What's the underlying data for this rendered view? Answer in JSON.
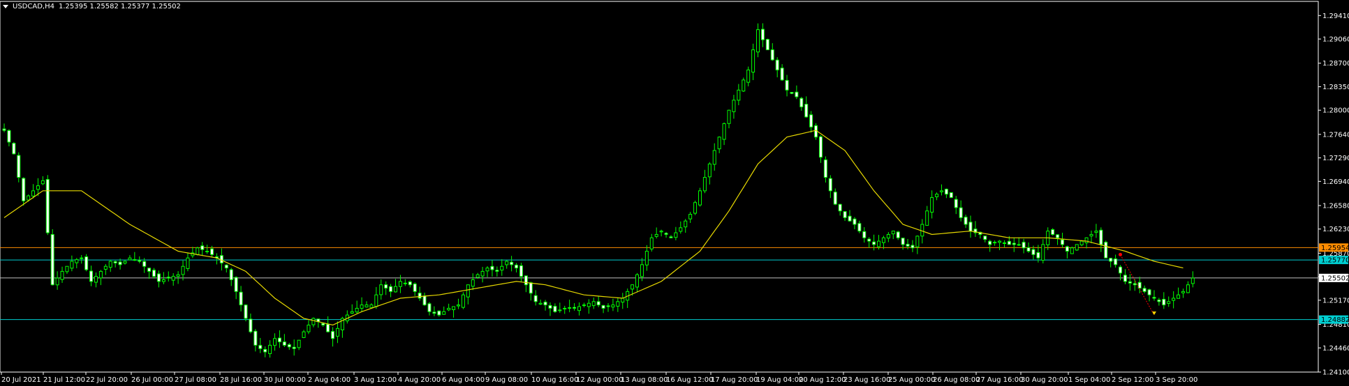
{
  "header": {
    "symbol": "USDCAD,H4",
    "ohlc": "1.25395 1.25582 1.25377 1.25502"
  },
  "price_axis": {
    "labels": [
      "1.29410",
      "1.29060",
      "1.28700",
      "1.28350",
      "1.28000",
      "1.27640",
      "1.27290",
      "1.26940",
      "1.26580",
      "1.26230",
      "1.25870",
      "1.25520",
      "1.25170",
      "1.24810",
      "1.24460",
      "1.24100"
    ]
  },
  "time_axis": {
    "labels": [
      "20 Jul 2021",
      "21 Jul 12:00",
      "22 Jul 20:00",
      "26 Jul 00:00",
      "27 Jul 08:00",
      "28 Jul 16:00",
      "30 Jul 00:00",
      "2 Aug 04:00",
      "3 Aug 12:00",
      "4 Aug 20:00",
      "6 Aug 04:00",
      "9 Aug 08:00",
      "10 Aug 16:00",
      "12 Aug 00:00",
      "13 Aug 08:00",
      "16 Aug 12:00",
      "17 Aug 20:00",
      "19 Aug 04:00",
      "20 Aug 12:00",
      "23 Aug 16:00",
      "25 Aug 00:00",
      "26 Aug 08:00",
      "27 Aug 16:00",
      "30 Aug 20:00",
      "1 Sep 04:00",
      "2 Sep 12:00",
      "3 Sep 20:00"
    ]
  },
  "price_tags": [
    {
      "name": "orange-level-tag",
      "value": "1.25954",
      "bg": "#FF8C00",
      "fg": "#000000"
    },
    {
      "name": "upper-cyan-level-tag",
      "value": "1.25770",
      "bg": "#00CED1",
      "fg": "#000000"
    },
    {
      "name": "current-price-tag",
      "value": "1.25502",
      "bg": "#FFFFFF",
      "fg": "#000000"
    },
    {
      "name": "lower-cyan-level-tag",
      "value": "1.24882",
      "bg": "#00CED1",
      "fg": "#000000"
    }
  ],
  "colors": {
    "background": "#000000",
    "candle": "#00FF00",
    "bull_body": "#FFFFFF",
    "bear_body": "#FFFFFF",
    "moving_average": "#E6D800",
    "orange_level": "#FF8C00",
    "cyan_level": "#00CED1",
    "current_price_line": "#C0C0C0",
    "trade_arrow": "#FF0000"
  },
  "chart_data": {
    "type": "candlestick",
    "symbol": "USDCAD",
    "timeframe": "H4",
    "ylim": [
      1.241,
      1.296
    ],
    "levels": {
      "orange": 1.25954,
      "cyan_upper": 1.2577,
      "current": 1.25502,
      "cyan_lower": 1.24882
    },
    "close_path": [
      [
        0,
        1.277
      ],
      [
        2,
        1.2735
      ],
      [
        4,
        1.2665
      ],
      [
        6,
        1.268
      ],
      [
        8,
        1.2695
      ],
      [
        10,
        1.254
      ],
      [
        12,
        1.256
      ],
      [
        14,
        1.2575
      ],
      [
        16,
        1.258
      ],
      [
        18,
        1.2545
      ],
      [
        20,
        1.256
      ],
      [
        22,
        1.2575
      ],
      [
        24,
        1.257
      ],
      [
        26,
        1.258
      ],
      [
        28,
        1.2575
      ],
      [
        30,
        1.256
      ],
      [
        32,
        1.2545
      ],
      [
        34,
        1.255
      ],
      [
        36,
        1.2555
      ],
      [
        38,
        1.258
      ],
      [
        40,
        1.2595
      ],
      [
        42,
        1.259
      ],
      [
        44,
        1.258
      ],
      [
        46,
        1.2565
      ],
      [
        48,
        1.253
      ],
      [
        50,
        1.249
      ],
      [
        52,
        1.245
      ],
      [
        54,
        1.244
      ],
      [
        56,
        1.246
      ],
      [
        58,
        1.245
      ],
      [
        60,
        1.2445
      ],
      [
        62,
        1.247
      ],
      [
        64,
        1.249
      ],
      [
        66,
        1.248
      ],
      [
        68,
        1.246
      ],
      [
        70,
        1.249
      ],
      [
        72,
        1.25
      ],
      [
        74,
        1.251
      ],
      [
        76,
        1.251
      ],
      [
        78,
        1.254
      ],
      [
        80,
        1.253
      ],
      [
        82,
        1.2545
      ],
      [
        84,
        1.254
      ],
      [
        86,
        1.252
      ],
      [
        88,
        1.25
      ],
      [
        90,
        1.2495
      ],
      [
        92,
        1.2505
      ],
      [
        94,
        1.251
      ],
      [
        96,
        1.254
      ],
      [
        98,
        1.2555
      ],
      [
        100,
        1.2565
      ],
      [
        102,
        1.256
      ],
      [
        104,
        1.2575
      ],
      [
        106,
        1.2565
      ],
      [
        108,
        1.254
      ],
      [
        110,
        1.2515
      ],
      [
        112,
        1.251
      ],
      [
        114,
        1.25
      ],
      [
        116,
        1.2505
      ],
      [
        118,
        1.2505
      ],
      [
        120,
        1.251
      ],
      [
        122,
        1.2515
      ],
      [
        124,
        1.2505
      ],
      [
        126,
        1.251
      ],
      [
        128,
        1.252
      ],
      [
        130,
        1.254
      ],
      [
        132,
        1.257
      ],
      [
        134,
        1.261
      ],
      [
        136,
        1.262
      ],
      [
        138,
        1.261
      ],
      [
        140,
        1.2625
      ],
      [
        142,
        1.2645
      ],
      [
        144,
        1.268
      ],
      [
        146,
        1.272
      ],
      [
        148,
        1.276
      ],
      [
        150,
        1.28
      ],
      [
        152,
        1.283
      ],
      [
        154,
        1.286
      ],
      [
        156,
        1.292
      ],
      [
        158,
        1.289
      ],
      [
        160,
        1.286
      ],
      [
        162,
        1.283
      ],
      [
        164,
        1.282
      ],
      [
        166,
        1.279
      ],
      [
        168,
        1.276
      ],
      [
        170,
        1.27
      ],
      [
        172,
        1.266
      ],
      [
        174,
        1.264
      ],
      [
        176,
        1.263
      ],
      [
        178,
        1.261
      ],
      [
        180,
        1.26
      ],
      [
        182,
        1.261
      ],
      [
        184,
        1.262
      ],
      [
        186,
        1.26
      ],
      [
        188,
        1.2595
      ],
      [
        190,
        1.263
      ],
      [
        192,
        1.267
      ],
      [
        194,
        1.268
      ],
      [
        196,
        1.267
      ],
      [
        198,
        1.264
      ],
      [
        200,
        1.262
      ],
      [
        202,
        1.2615
      ],
      [
        204,
        1.26
      ],
      [
        206,
        1.2605
      ],
      [
        208,
        1.26
      ],
      [
        210,
        1.26
      ],
      [
        212,
        1.259
      ],
      [
        214,
        1.258
      ],
      [
        216,
        1.262
      ],
      [
        218,
        1.261
      ],
      [
        220,
        1.259
      ],
      [
        222,
        1.26
      ],
      [
        224,
        1.261
      ],
      [
        226,
        1.262
      ],
      [
        228,
        1.258
      ],
      [
        230,
        1.257
      ],
      [
        232,
        1.2545
      ],
      [
        234,
        1.254
      ],
      [
        236,
        1.253
      ],
      [
        238,
        1.252
      ],
      [
        240,
        1.251
      ],
      [
        242,
        1.252
      ],
      [
        244,
        1.253
      ],
      [
        246,
        1.255
      ]
    ],
    "moving_average_path": [
      [
        0,
        1.264
      ],
      [
        8,
        1.268
      ],
      [
        16,
        1.268
      ],
      [
        26,
        1.263
      ],
      [
        36,
        1.259
      ],
      [
        44,
        1.258
      ],
      [
        50,
        1.256
      ],
      [
        56,
        1.252
      ],
      [
        62,
        1.249
      ],
      [
        68,
        1.248
      ],
      [
        74,
        1.25
      ],
      [
        82,
        1.252
      ],
      [
        90,
        1.2525
      ],
      [
        98,
        1.2535
      ],
      [
        106,
        1.2545
      ],
      [
        112,
        1.254
      ],
      [
        120,
        1.2525
      ],
      [
        128,
        1.252
      ],
      [
        136,
        1.2545
      ],
      [
        144,
        1.259
      ],
      [
        150,
        1.265
      ],
      [
        156,
        1.272
      ],
      [
        162,
        1.276
      ],
      [
        168,
        1.277
      ],
      [
        174,
        1.274
      ],
      [
        180,
        1.268
      ],
      [
        186,
        1.263
      ],
      [
        192,
        1.2615
      ],
      [
        200,
        1.262
      ],
      [
        208,
        1.261
      ],
      [
        216,
        1.261
      ],
      [
        224,
        1.2605
      ],
      [
        232,
        1.259
      ],
      [
        238,
        1.2575
      ],
      [
        244,
        1.2565
      ]
    ]
  }
}
